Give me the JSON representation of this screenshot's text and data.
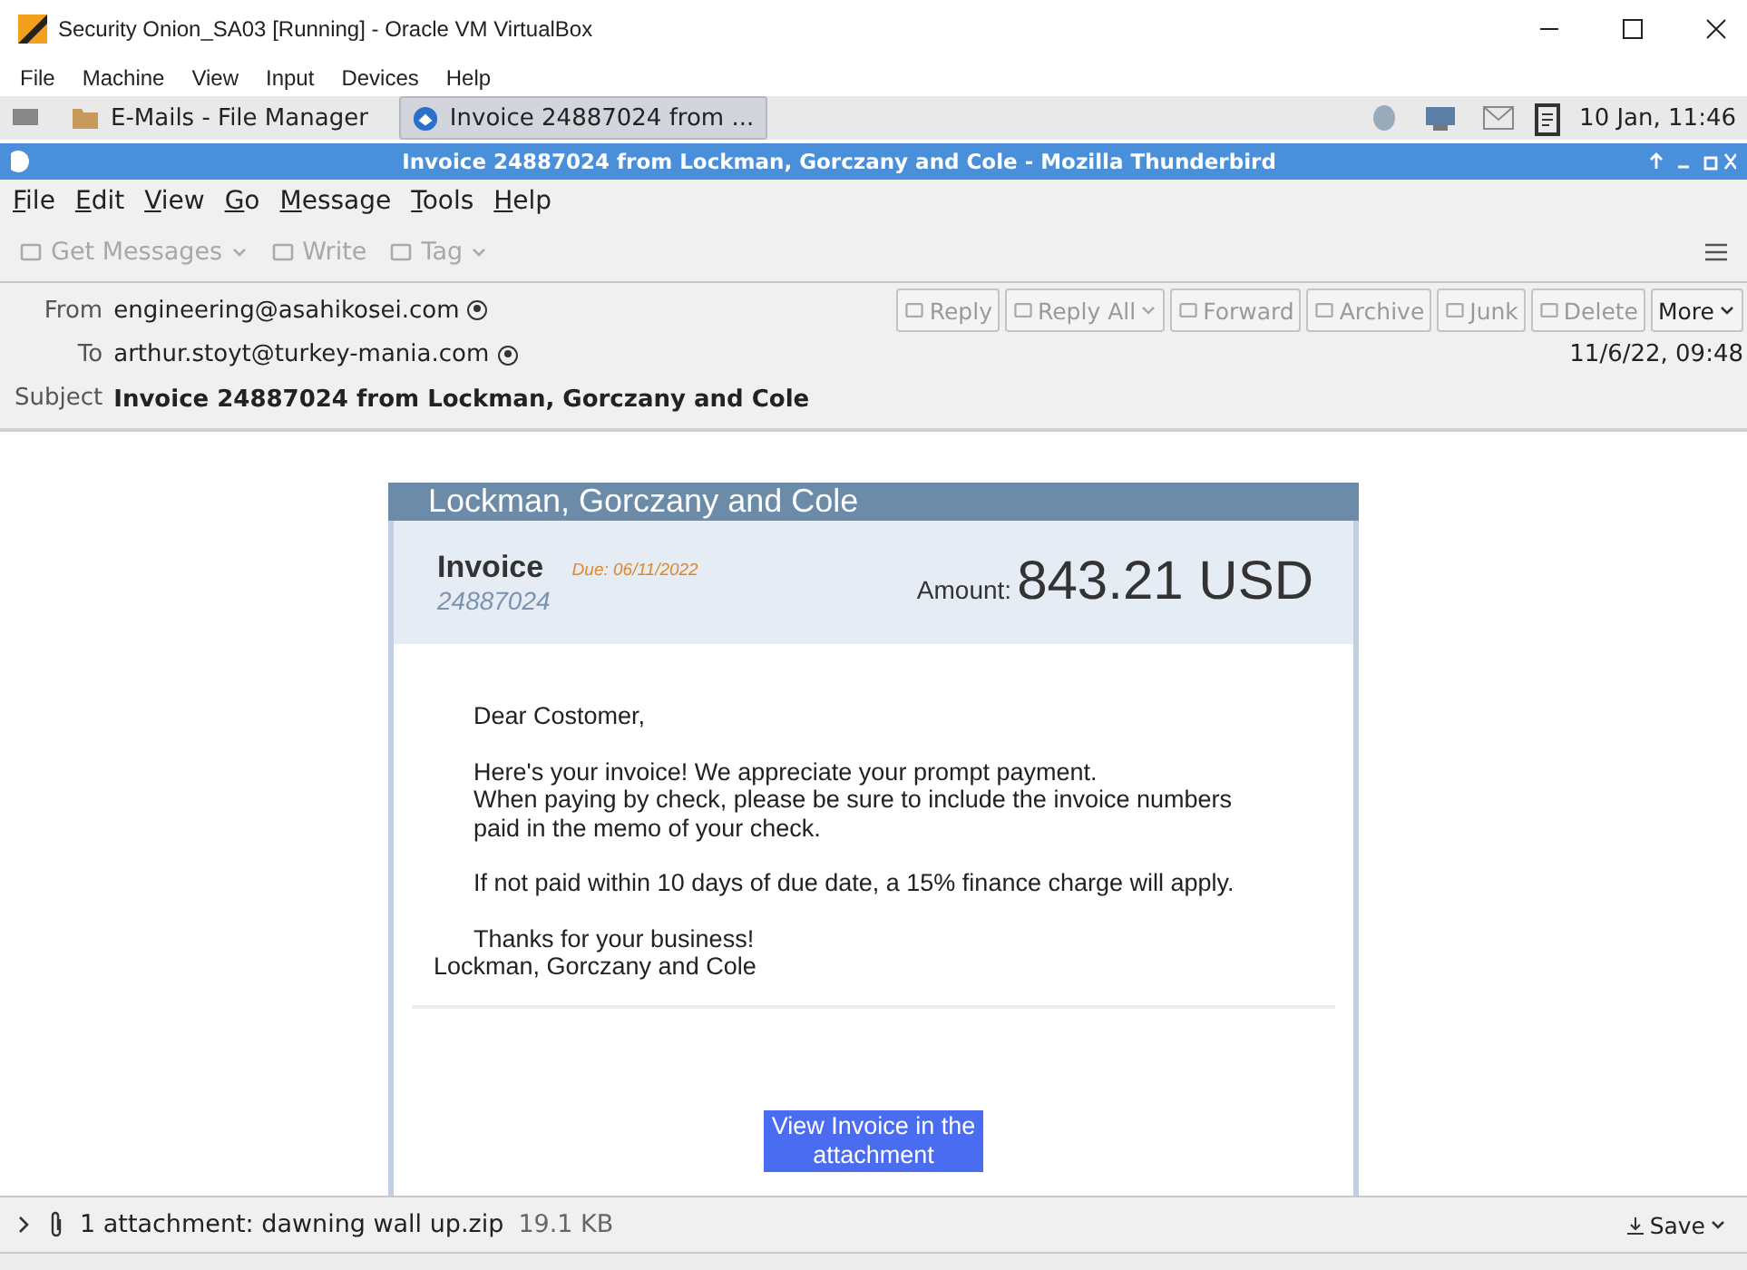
{
  "vm_window": {
    "title": "Security Onion_SA03 [Running] - Oracle VM VirtualBox",
    "menu": [
      "File",
      "Machine",
      "View",
      "Input",
      "Devices",
      "Help"
    ]
  },
  "taskbar": {
    "tasks": [
      {
        "label": "E-Mails - File Manager",
        "selected": false,
        "kind": "folder"
      },
      {
        "label": "Invoice 24887024 from ...",
        "selected": true,
        "kind": "mail"
      }
    ],
    "clock": "10 Jan, 11:46"
  },
  "app_window": {
    "title": "Invoice 24887024 from Lockman, Gorczany and Cole - Mozilla Thunderbird",
    "menu": [
      "File",
      "Edit",
      "View",
      "Go",
      "Message",
      "Tools",
      "Help"
    ]
  },
  "toolbar": [
    {
      "label": "Get Messages",
      "disabled": true,
      "dropdown": true
    },
    {
      "label": "Write",
      "disabled": true,
      "dropdown": false
    },
    {
      "label": "Tag",
      "disabled": true,
      "dropdown": true
    }
  ],
  "header": {
    "from_label": "From",
    "from": "engineering@asahikosei.com",
    "to_label": "To",
    "to": "arthur.stoyt@turkey-mania.com",
    "subject_label": "Subject",
    "subject": "Invoice 24887024 from Lockman, Gorczany and Cole",
    "date": "11/6/22, 09:48",
    "actions": [
      {
        "label": "Reply",
        "disabled": true,
        "dropdown": false
      },
      {
        "label": "Reply All",
        "disabled": true,
        "dropdown": true
      },
      {
        "label": "Forward",
        "disabled": true,
        "dropdown": false
      },
      {
        "label": "Archive",
        "disabled": true,
        "dropdown": false
      },
      {
        "label": "Junk",
        "disabled": true,
        "dropdown": false
      },
      {
        "label": "Delete",
        "disabled": true,
        "dropdown": false
      },
      {
        "label": "More",
        "disabled": false,
        "dropdown": true
      }
    ]
  },
  "invoice": {
    "company": "Lockman, Gorczany and Cole",
    "label": "Invoice",
    "number": "24887024",
    "due": "Due: 06/11/2022",
    "amount_label": "Amount:",
    "amount": "843.21 USD",
    "paragraphs": [
      [
        "Dear Costomer,"
      ],
      [
        "Here's your invoice! We appreciate your prompt payment.",
        "When paying by check, please be sure to include the invoice numbers",
        "paid in the memo of your check."
      ],
      [
        "If not paid within 10 days of due date, a 15% finance charge will apply."
      ],
      [
        "Thanks for your business!"
      ]
    ],
    "signature": "Lockman, Gorczany and Cole",
    "button": [
      "View Invoice in the",
      "attachment"
    ]
  },
  "attachment_bar": {
    "text": "1 attachment: dawning wall up.zip",
    "size": "19.1 KB",
    "save": "Save"
  }
}
